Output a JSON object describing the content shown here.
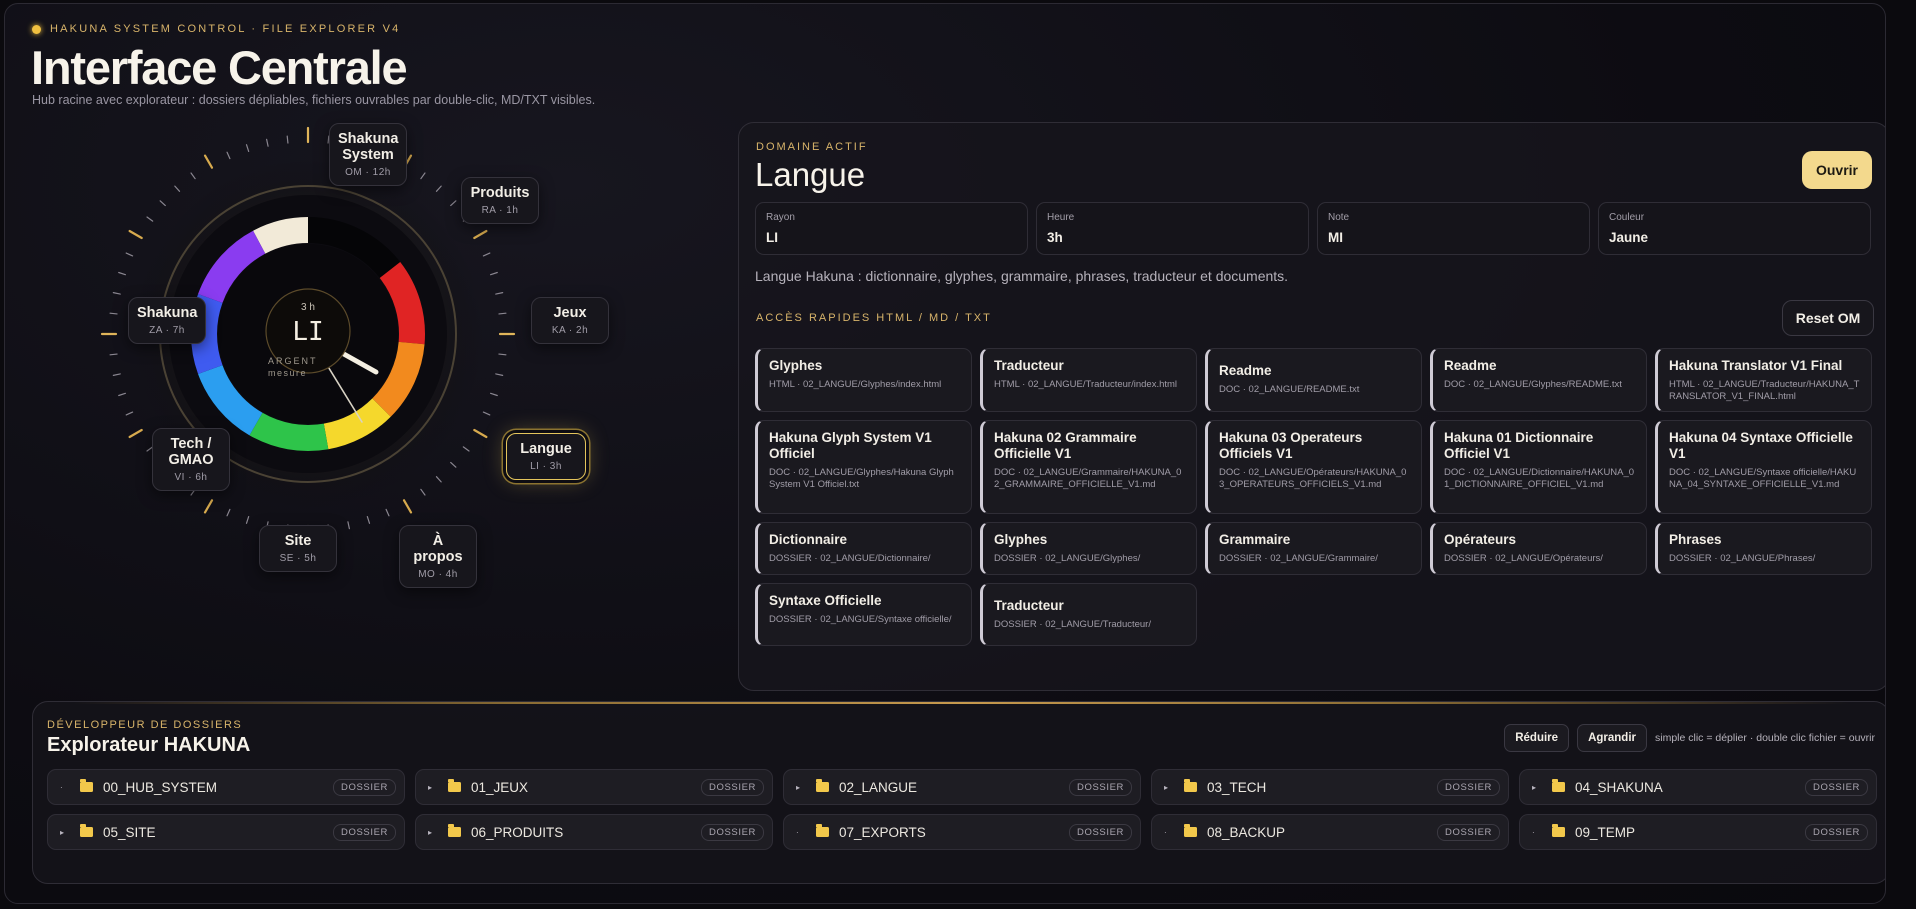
{
  "header": {
    "eyebrow": "HAKUNA SYSTEM CONTROL · FILE EXPLORER V4",
    "title": "Interface Centrale",
    "subtitle": "Hub racine avec explorateur : dossiers dépliables, fichiers ouvrables par double-clic, MD/TXT visibles."
  },
  "dial": {
    "center_hour": "3 h",
    "center_code": "LI",
    "center_label": "ARGENT",
    "center_sub": "mesure",
    "nodes": [
      {
        "name": "Shakuna System",
        "sub": "OM · 12h"
      },
      {
        "name": "Produits",
        "sub": "RA · 1h"
      },
      {
        "name": "Jeux",
        "sub": "KA · 2h"
      },
      {
        "name": "Langue",
        "sub": "LI · 3h"
      },
      {
        "name": "À propos",
        "sub": "MO · 4h"
      },
      {
        "name": "Site",
        "sub": "SE · 5h"
      },
      {
        "name": "Tech / GMAO",
        "sub": "VI · 6h"
      },
      {
        "name": "Shakuna",
        "sub": "ZA · 7h"
      }
    ],
    "ring_colors": [
      "#f2ead8",
      "#e02424",
      "#f28a1e",
      "#f5d82c",
      "#2ec44a",
      "#2b9ef0",
      "#3f5bf0",
      "#8a3cf0"
    ]
  },
  "domain": {
    "eyebrow": "DOMAINE ACTIF",
    "title": "Langue",
    "open_label": "Ouvrir",
    "fields": [
      {
        "label": "Rayon",
        "value": "LI"
      },
      {
        "label": "Heure",
        "value": "3h"
      },
      {
        "label": "Note",
        "value": "MI"
      },
      {
        "label": "Couleur",
        "value": "Jaune"
      }
    ],
    "description": "Langue Hakuna : dictionnaire, glyphes, grammaire, phrases, traducteur et documents.",
    "quick_label": "ACCÈS RAPIDES HTML / MD / TXT",
    "reset_label": "Reset OM",
    "cards": [
      {
        "name": "Glyphes",
        "path": "HTML · 02_LANGUE/Glyphes/index.html"
      },
      {
        "name": "Traducteur",
        "path": "HTML · 02_LANGUE/Traducteur/index.html"
      },
      {
        "name": "Readme",
        "path": "DOC · 02_LANGUE/README.txt"
      },
      {
        "name": "Readme",
        "path": "DOC · 02_LANGUE/Glyphes/README.txt"
      },
      {
        "name": "Hakuna Translator V1 Final",
        "path": "HTML · 02_LANGUE/Traducteur/HAKUNA_TRANSLATOR_V1_FINAL.html"
      },
      {
        "name": "Hakuna Glyph System V1 Officiel",
        "path": "DOC · 02_LANGUE/Glyphes/Hakuna Glyph System V1 Officiel.txt"
      },
      {
        "name": "Hakuna 02 Grammaire Officielle V1",
        "path": "DOC · 02_LANGUE/Grammaire/HAKUNA_02_GRAMMAIRE_OFFICIELLE_V1.md"
      },
      {
        "name": "Hakuna 03 Operateurs Officiels V1",
        "path": "DOC · 02_LANGUE/Opérateurs/HAKUNA_03_OPERATEURS_OFFICIELS_V1.md"
      },
      {
        "name": "Hakuna 01 Dictionnaire Officiel V1",
        "path": "DOC · 02_LANGUE/Dictionnaire/HAKUNA_01_DICTIONNAIRE_OFFICIEL_V1.md"
      },
      {
        "name": "Hakuna 04 Syntaxe Officielle V1",
        "path": "DOC · 02_LANGUE/Syntaxe officielle/HAKUNA_04_SYNTAXE_OFFICIELLE_V1.md"
      },
      {
        "name": "Dictionnaire",
        "path": "DOSSIER · 02_LANGUE/Dictionnaire/"
      },
      {
        "name": "Glyphes",
        "path": "DOSSIER · 02_LANGUE/Glyphes/"
      },
      {
        "name": "Grammaire",
        "path": "DOSSIER · 02_LANGUE/Grammaire/"
      },
      {
        "name": "Opérateurs",
        "path": "DOSSIER · 02_LANGUE/Opérateurs/"
      },
      {
        "name": "Phrases",
        "path": "DOSSIER · 02_LANGUE/Phrases/"
      },
      {
        "name": "Syntaxe Officielle",
        "path": "DOSSIER · 02_LANGUE/Syntaxe officielle/"
      },
      {
        "name": "Traducteur",
        "path": "DOSSIER · 02_LANGUE/Traducteur/"
      }
    ]
  },
  "explorer": {
    "eyebrow": "DÉVELOPPEUR DE DOSSIERS",
    "title": "Explorateur HAKUNA",
    "reduce_label": "Réduire",
    "expand_label": "Agrandir",
    "hint": "simple clic = déplier · double clic fichier = ouvrir",
    "folders": [
      {
        "name": "00_HUB_SYSTEM",
        "badge": "DOSSIER",
        "arrow": "·"
      },
      {
        "name": "01_JEUX",
        "badge": "DOSSIER",
        "arrow": "▸"
      },
      {
        "name": "02_LANGUE",
        "badge": "DOSSIER",
        "arrow": "▸"
      },
      {
        "name": "03_TECH",
        "badge": "DOSSIER",
        "arrow": "▸"
      },
      {
        "name": "04_SHAKUNA",
        "badge": "DOSSIER",
        "arrow": "▸"
      },
      {
        "name": "05_SITE",
        "badge": "DOSSIER",
        "arrow": "▸"
      },
      {
        "name": "06_PRODUITS",
        "badge": "DOSSIER",
        "arrow": "▸"
      },
      {
        "name": "07_EXPORTS",
        "badge": "DOSSIER",
        "arrow": "·"
      },
      {
        "name": "08_BACKUP",
        "badge": "DOSSIER",
        "arrow": "·"
      },
      {
        "name": "09_TEMP",
        "badge": "DOSSIER",
        "arrow": "·"
      }
    ]
  }
}
